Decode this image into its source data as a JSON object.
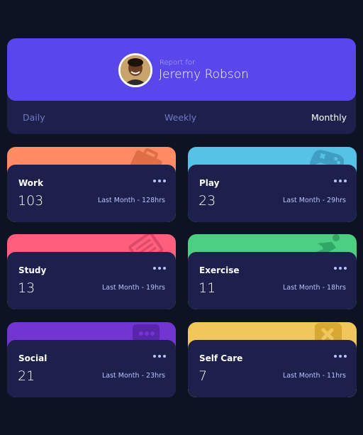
{
  "profile": {
    "report_for": "Report for",
    "name": "Jeremy Robson"
  },
  "tabs": [
    {
      "label": "Daily",
      "active": false
    },
    {
      "label": "Weekly",
      "active": false
    },
    {
      "label": "Monthly",
      "active": true
    }
  ],
  "cards": [
    {
      "title": "Work",
      "current": "103",
      "previous": "Last Month - 128hrs",
      "color": "#ff8b64",
      "icon": "work-briefcase-icon"
    },
    {
      "title": "Play",
      "current": "23",
      "previous": "Last Month - 29hrs",
      "color": "#55c2e6",
      "icon": "play-gamepad-icon"
    },
    {
      "title": "Study",
      "current": "13",
      "previous": "Last Month - 19hrs",
      "color": "#ff5e7d",
      "icon": "study-book-icon"
    },
    {
      "title": "Exercise",
      "current": "11",
      "previous": "Last Month - 18hrs",
      "color": "#4bcf82",
      "icon": "exercise-runner-icon"
    },
    {
      "title": "Social",
      "current": "21",
      "previous": "Last Month - 23hrs",
      "color": "#7335d2",
      "icon": "social-chat-icon"
    },
    {
      "title": "Self Care",
      "current": "7",
      "previous": "Last Month - 11hrs",
      "color": "#f1c75b",
      "icon": "self-care-heart-icon"
    }
  ]
}
